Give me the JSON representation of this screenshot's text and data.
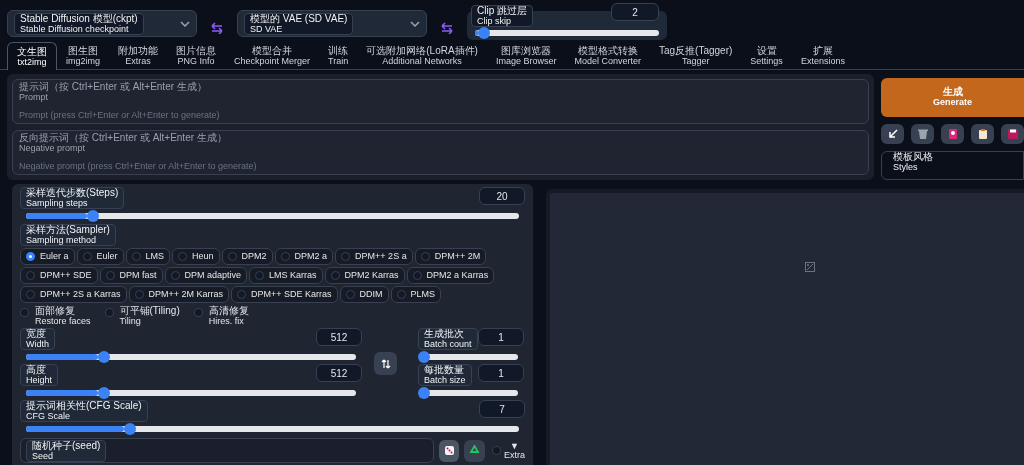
{
  "model_bar": {
    "checkpoint": {
      "label": "Stable Diffusion 模型(ckpt)",
      "sublabel": "Stable Diffusion checkpoint"
    },
    "vae": {
      "label": "模型的 VAE (SD VAE)",
      "sublabel": "SD VAE"
    },
    "clip_skip": {
      "label": "Clip 跳过层",
      "sublabel": "Clip skip",
      "value": "2",
      "level": 0.05
    }
  },
  "tabs": [
    {
      "label": "文生图",
      "sublabel": "txt2img",
      "selected": true
    },
    {
      "label": "图生图",
      "sublabel": "img2img",
      "selected": false
    },
    {
      "label": "附加功能",
      "sublabel": "Extras",
      "selected": false
    },
    {
      "label": "图片信息",
      "sublabel": "PNG Info",
      "selected": false
    },
    {
      "label": "模型合并",
      "sublabel": "Checkpoint Merger",
      "selected": false
    },
    {
      "label": "训练",
      "sublabel": "Train",
      "selected": false
    },
    {
      "label": "可选附加网络(LoRA插件)",
      "sublabel": "Additional Networks",
      "selected": false
    },
    {
      "label": "图库浏览器",
      "sublabel": "Image Browser",
      "selected": false
    },
    {
      "label": "模型格式转换",
      "sublabel": "Model Converter",
      "selected": false
    },
    {
      "label": "Tag反推(Tagger)",
      "sublabel": "Tagger",
      "selected": false
    },
    {
      "label": "设置",
      "sublabel": "Settings",
      "selected": false
    },
    {
      "label": "扩展",
      "sublabel": "Extensions",
      "selected": false
    }
  ],
  "prompt": {
    "label": "提示词（按 Ctrl+Enter 或 Alt+Enter 生成）",
    "sublabel": "Prompt",
    "placeholder": "Prompt (press Ctrl+Enter or Alt+Enter to generate)"
  },
  "negative_prompt": {
    "label": "反向提示词（按 Ctrl+Enter 或 Alt+Enter 生成）",
    "sublabel": "Negative prompt",
    "placeholder": "Negative prompt (press Ctrl+Enter or Alt+Enter to generate)"
  },
  "generate_button": {
    "label": "生成",
    "sublabel": "Generate"
  },
  "tool_buttons": [
    {
      "kind": "arrow"
    },
    {
      "kind": "trash"
    },
    {
      "kind": "card"
    },
    {
      "kind": "clipboard"
    },
    {
      "kind": "save"
    }
  ],
  "styles": {
    "label": "模板风格",
    "sublabel": "Styles"
  },
  "sampling_steps": {
    "label": "采样迭代步数(Steps)",
    "sublabel": "Sampling steps",
    "value": "20",
    "level": 0.135
  },
  "sampler": {
    "label": "采样方法(Sampler)",
    "sublabel": "Sampling method",
    "options": [
      {
        "label": "Euler a",
        "selected": true
      },
      {
        "label": "Euler",
        "selected": false
      },
      {
        "label": "LMS",
        "selected": false
      },
      {
        "label": "Heun",
        "selected": false
      },
      {
        "label": "DPM2",
        "selected": false
      },
      {
        "label": "DPM2 a",
        "selected": false
      },
      {
        "label": "DPM++ 2S a",
        "selected": false
      },
      {
        "label": "DPM++ 2M",
        "selected": false
      },
      {
        "label": "DPM++ SDE",
        "selected": false
      },
      {
        "label": "DPM fast",
        "selected": false
      },
      {
        "label": "DPM adaptive",
        "selected": false
      },
      {
        "label": "LMS Karras",
        "selected": false
      },
      {
        "label": "DPM2 Karras",
        "selected": false
      },
      {
        "label": "DPM2 a Karras",
        "selected": false
      },
      {
        "label": "DPM++ 2S a Karras",
        "selected": false
      },
      {
        "label": "DPM++ 2M Karras",
        "selected": false
      },
      {
        "label": "DPM++ SDE Karras",
        "selected": false
      },
      {
        "label": "DDIM",
        "selected": false
      },
      {
        "label": "PLMS",
        "selected": false
      }
    ]
  },
  "options": [
    {
      "label": "面部修复",
      "sublabel": "Restore faces",
      "checked": false
    },
    {
      "label": "可平铺(Tiling)",
      "sublabel": "Tiling",
      "checked": false
    },
    {
      "label": "高清修复",
      "sublabel": "Hires. fix",
      "checked": false
    }
  ],
  "width": {
    "label": "宽度",
    "sublabel": "Width",
    "value": "512",
    "level": 0.235
  },
  "height": {
    "label": "高度",
    "sublabel": "Height",
    "value": "512",
    "level": 0.235
  },
  "batch_count": {
    "label": "生成批次",
    "sublabel": "Batch count",
    "value": "1",
    "level": 0
  },
  "batch_size": {
    "label": "每批数量",
    "sublabel": "Batch size",
    "value": "1",
    "level": 0
  },
  "cfg_scale": {
    "label": "提示词相关性(CFG Scale)",
    "sublabel": "CFG Scale",
    "value": "7",
    "level": 0.21
  },
  "seed": {
    "label": "随机种子(seed)",
    "sublabel": "Seed"
  },
  "extra": {
    "arrow": "▼",
    "label": "Extra",
    "checked": false
  }
}
